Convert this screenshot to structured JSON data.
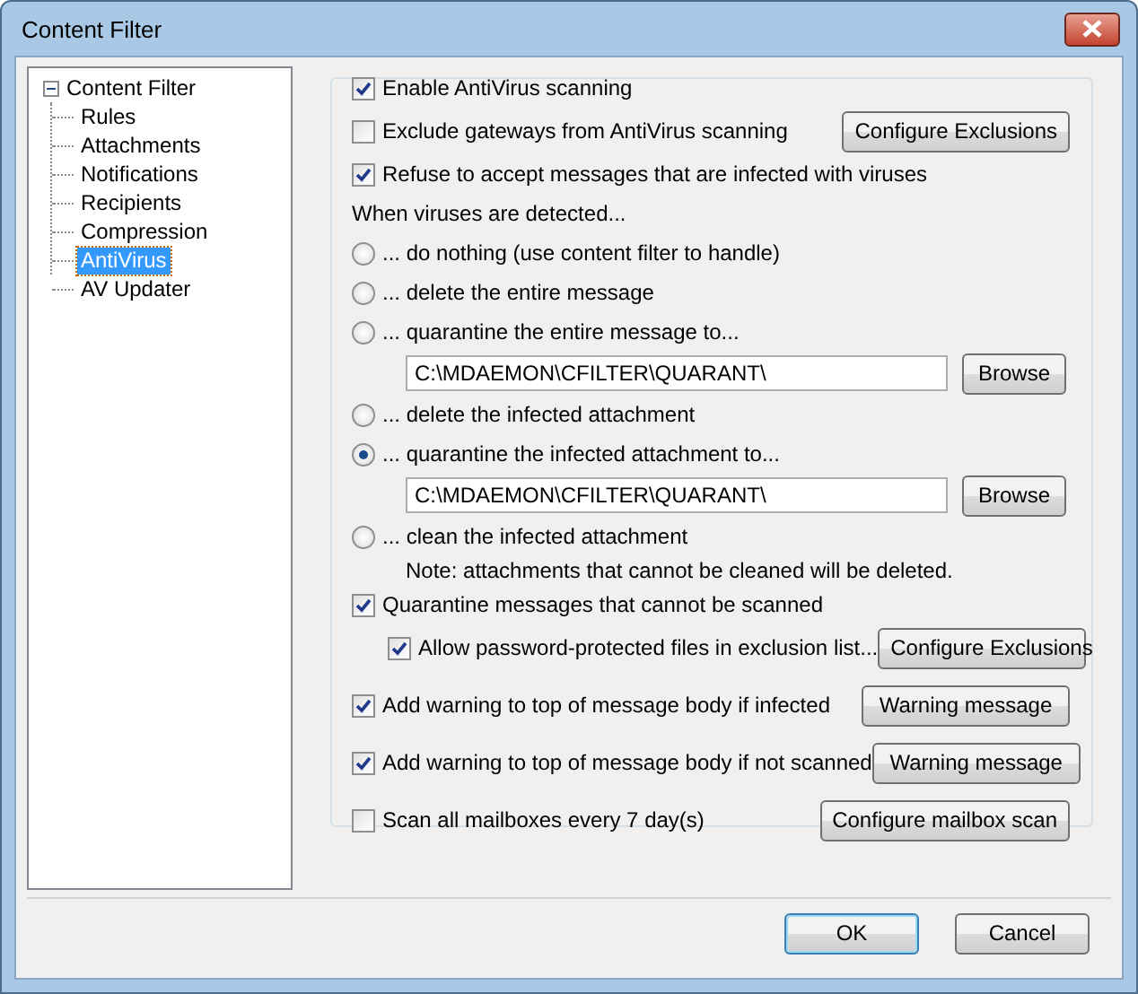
{
  "window": {
    "title": "Content Filter"
  },
  "tree": {
    "label": "Content Filter",
    "expanded": true,
    "children": [
      {
        "label": "Rules",
        "selected": false
      },
      {
        "label": "Attachments",
        "selected": false
      },
      {
        "label": "Notifications",
        "selected": false
      },
      {
        "label": "Recipients",
        "selected": false
      },
      {
        "label": "Compression",
        "selected": false
      },
      {
        "label": "AntiVirus",
        "selected": true
      },
      {
        "label": "AV Updater",
        "selected": false
      }
    ]
  },
  "options": [
    {
      "kind": "checkbox",
      "label": "Enable AntiVirus scanning",
      "checked": true
    },
    {
      "kind": "checkbox",
      "label": "Exclude gateways from AntiVirus scanning",
      "checked": false,
      "button": "Configure Exclusions"
    },
    {
      "kind": "checkbox",
      "label": "Refuse to accept messages that are infected with viruses",
      "checked": true
    },
    {
      "kind": "label",
      "label": "When viruses are detected..."
    },
    {
      "kind": "radio",
      "label": "... do nothing (use content filter to handle)",
      "selected": false
    },
    {
      "kind": "radio",
      "label": "... delete the entire message",
      "selected": false
    },
    {
      "kind": "radio",
      "label": "... quarantine the entire message to...",
      "selected": false
    },
    {
      "kind": "path",
      "value": "C:\\MDAEMON\\CFILTER\\QUARANT\\",
      "button": "Browse"
    },
    {
      "kind": "radio",
      "label": "... delete the infected attachment",
      "selected": false
    },
    {
      "kind": "radio",
      "label": "... quarantine the infected attachment to...",
      "selected": true
    },
    {
      "kind": "path",
      "value": "C:\\MDAEMON\\CFILTER\\QUARANT\\",
      "button": "Browse"
    },
    {
      "kind": "radio",
      "label": "... clean the infected attachment",
      "selected": false
    },
    {
      "kind": "note",
      "label": "Note: attachments that cannot be cleaned will be deleted."
    },
    {
      "kind": "checkbox",
      "label": "Quarantine messages that cannot be scanned",
      "checked": true
    },
    {
      "kind": "subcheckbox",
      "label": "Allow password-protected files in exclusion list...",
      "checked": true,
      "button": "Configure Exclusions"
    },
    {
      "kind": "checkbox",
      "label": "Add warning to top of message body if infected",
      "checked": true,
      "button": "Warning message"
    },
    {
      "kind": "checkbox",
      "label": "Add warning to top of message body if not scanned",
      "checked": true,
      "button": "Warning message"
    },
    {
      "kind": "checkbox",
      "label": "Scan all mailboxes every 7 day(s)",
      "checked": false,
      "button": "Configure mailbox scan"
    }
  ],
  "buttons": [
    "OK",
    "Cancel"
  ]
}
